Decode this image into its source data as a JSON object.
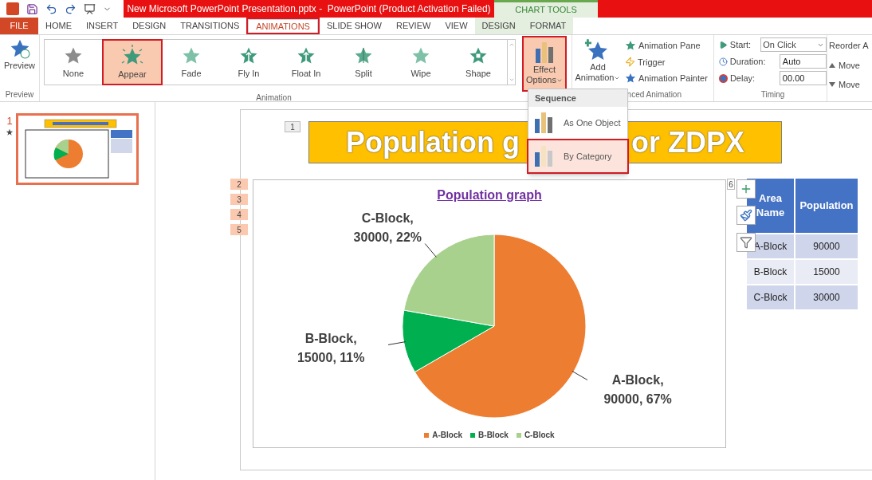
{
  "title_bar": {
    "title": "New Microsoft PowerPoint Presentation.pptx -  PowerPoint (Product Activation Failed)",
    "context_label": "CHART TOOLS"
  },
  "tabs": [
    {
      "label": "FILE",
      "kind": "file",
      "selected": false,
      "annotated": false
    },
    {
      "label": "HOME",
      "kind": "main",
      "selected": false,
      "annotated": false
    },
    {
      "label": "INSERT",
      "kind": "main",
      "selected": false,
      "annotated": false
    },
    {
      "label": "DESIGN",
      "kind": "main",
      "selected": false,
      "annotated": false
    },
    {
      "label": "TRANSITIONS",
      "kind": "main",
      "selected": false,
      "annotated": false
    },
    {
      "label": "ANIMATIONS",
      "kind": "main",
      "selected": true,
      "annotated": true
    },
    {
      "label": "SLIDE SHOW",
      "kind": "main",
      "selected": false,
      "annotated": false
    },
    {
      "label": "REVIEW",
      "kind": "main",
      "selected": false,
      "annotated": false
    },
    {
      "label": "VIEW",
      "kind": "main",
      "selected": false,
      "annotated": false
    },
    {
      "label": "DESIGN",
      "kind": "context",
      "selected": false,
      "annotated": false
    },
    {
      "label": "FORMAT",
      "kind": "context",
      "selected": false,
      "annotated": false
    }
  ],
  "ribbon": {
    "preview": {
      "label": "Preview",
      "group": "Preview"
    },
    "gallery": {
      "group": "Animation",
      "items": [
        {
          "label": "None",
          "kind": "none",
          "selected": false,
          "annotated": false
        },
        {
          "label": "Appear",
          "kind": "burst",
          "selected": true,
          "annotated": true
        },
        {
          "label": "Fade",
          "kind": "fade",
          "selected": false,
          "annotated": false
        },
        {
          "label": "Fly In",
          "kind": "arrow",
          "selected": false,
          "annotated": false
        },
        {
          "label": "Float In",
          "kind": "arrow",
          "selected": false,
          "annotated": false
        },
        {
          "label": "Split",
          "kind": "split",
          "selected": false,
          "annotated": false
        },
        {
          "label": "Wipe",
          "kind": "fade",
          "selected": false,
          "annotated": false
        },
        {
          "label": "Shape",
          "kind": "shape",
          "selected": false,
          "annotated": false
        }
      ]
    },
    "effect_options": {
      "lines": [
        "Effect",
        "Options"
      ],
      "annotated": true,
      "expanded": true
    },
    "add_animation": {
      "lines": [
        "Add",
        "Animation"
      ]
    },
    "advanced": {
      "group": "nced Animation",
      "items": [
        "Animation Pane",
        "Trigger",
        "Animation Painter"
      ]
    },
    "timing": {
      "group": "Timing",
      "start_label": "Start:",
      "start_value": "On Click",
      "duration_label": "Duration:",
      "duration_value": "Auto",
      "delay_label": "Delay:",
      "delay_value": "00.00"
    },
    "reorder": {
      "title": "Reorder A",
      "items": [
        "Move",
        "Move"
      ]
    }
  },
  "menu": {
    "header": "Sequence",
    "items": [
      {
        "label": "As One Object",
        "selected": false,
        "annotated": false
      },
      {
        "label": "By Category",
        "selected": true,
        "annotated": true
      }
    ]
  },
  "thumbnails": [
    {
      "number": "1",
      "selected": true
    }
  ],
  "slide": {
    "title_parts": [
      "Population g",
      "or ZDPX"
    ],
    "tags": [
      "1",
      "2",
      "3",
      "4",
      "5",
      "6"
    ],
    "chart": {
      "chart_data": {
        "type": "pie",
        "title": "Population graph",
        "categories": [
          "A-Block",
          "B-Block",
          "C-Block"
        ],
        "values": [
          90000,
          15000,
          30000
        ],
        "colors": [
          "#ed7d31",
          "#00b050",
          "#a9d18e"
        ],
        "value_labels": [
          "A-Block, 90000, 67%",
          "B-Block, 15000, 11%",
          "C-Block, 30000, 22%"
        ],
        "legend": true
      }
    },
    "table": {
      "columns": [
        "Area Name",
        "Population"
      ],
      "rows": [
        [
          "A-Block",
          "90000"
        ],
        [
          "B-Block",
          "15000"
        ],
        [
          "C-Block",
          "30000"
        ]
      ]
    }
  }
}
